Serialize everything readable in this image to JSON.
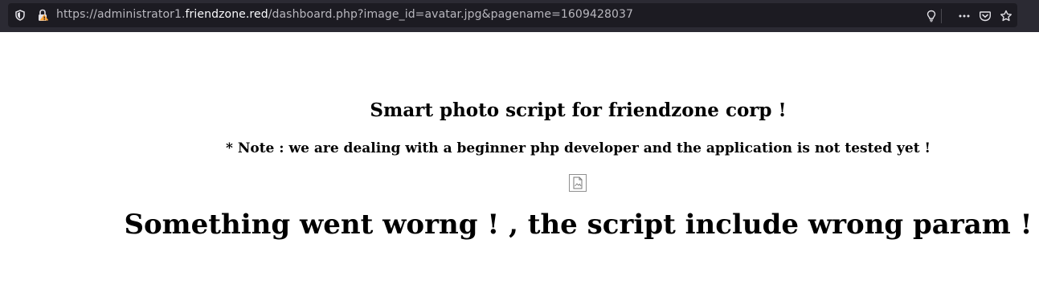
{
  "browser": {
    "url_prefix": "https://administrator1.",
    "url_host": "friendzone.red",
    "url_path": "/dashboard.php?image_id=avatar.jpg&pagename=1609428037"
  },
  "page": {
    "title": "Smart photo script for friendzone corp !",
    "note": "* Note : we are dealing with a beginner php developer and the application is not tested yet !",
    "error": "Something went worng ! , the script include wrong param !"
  },
  "colors": {
    "toolbar_bg": "#2b2a33",
    "urlbar_bg": "#1c1b22",
    "url_text": "#b8b7be",
    "url_host_text": "#fbfbfe",
    "lock_warning": "#ffa436"
  }
}
